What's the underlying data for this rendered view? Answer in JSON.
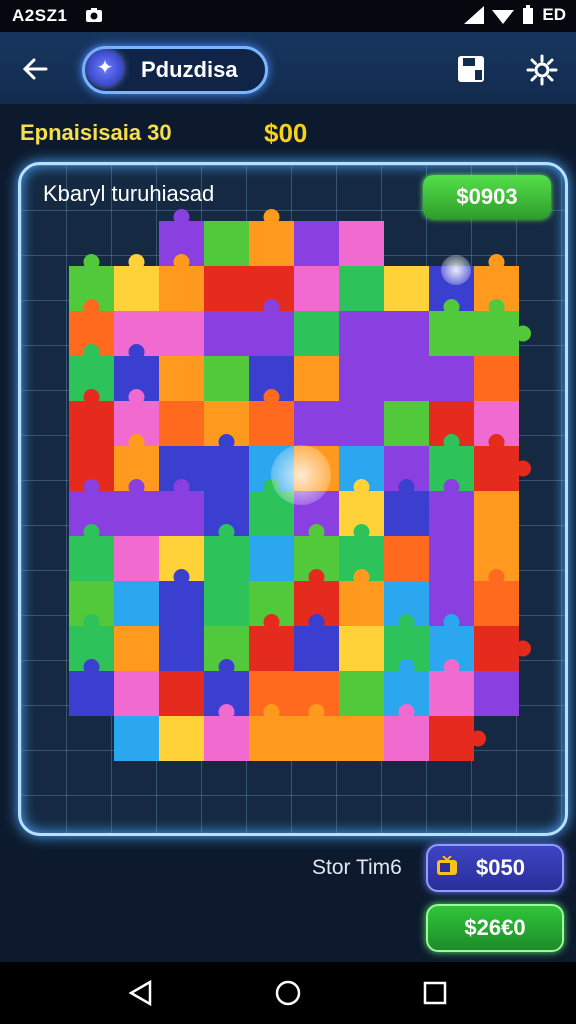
{
  "status_bar": {
    "time": "A2SZ1",
    "network_label": "ED"
  },
  "app_bar": {
    "title": "Pduzdisa"
  },
  "info": {
    "level_text": "Epnaisisaia 30",
    "coins": "$00"
  },
  "board": {
    "label": "Kbaryl turuhiasad",
    "score": "$0903"
  },
  "footer": {
    "timer_label": "Stor Tim6",
    "timer_value": "$050",
    "bonus_value": "$26€0"
  },
  "colors": {
    "accent": "#4ea9ff",
    "score_green": "#3fbf34",
    "timer_blue": "#3a40bd",
    "coin_yellow": "#f7d11b"
  },
  "icons": [
    "back-arrow-icon",
    "plus-star-icon",
    "save-icon",
    "gear-icon",
    "tv-icon",
    "triangle-back-icon",
    "circle-home-icon",
    "square-recents-icon"
  ]
}
